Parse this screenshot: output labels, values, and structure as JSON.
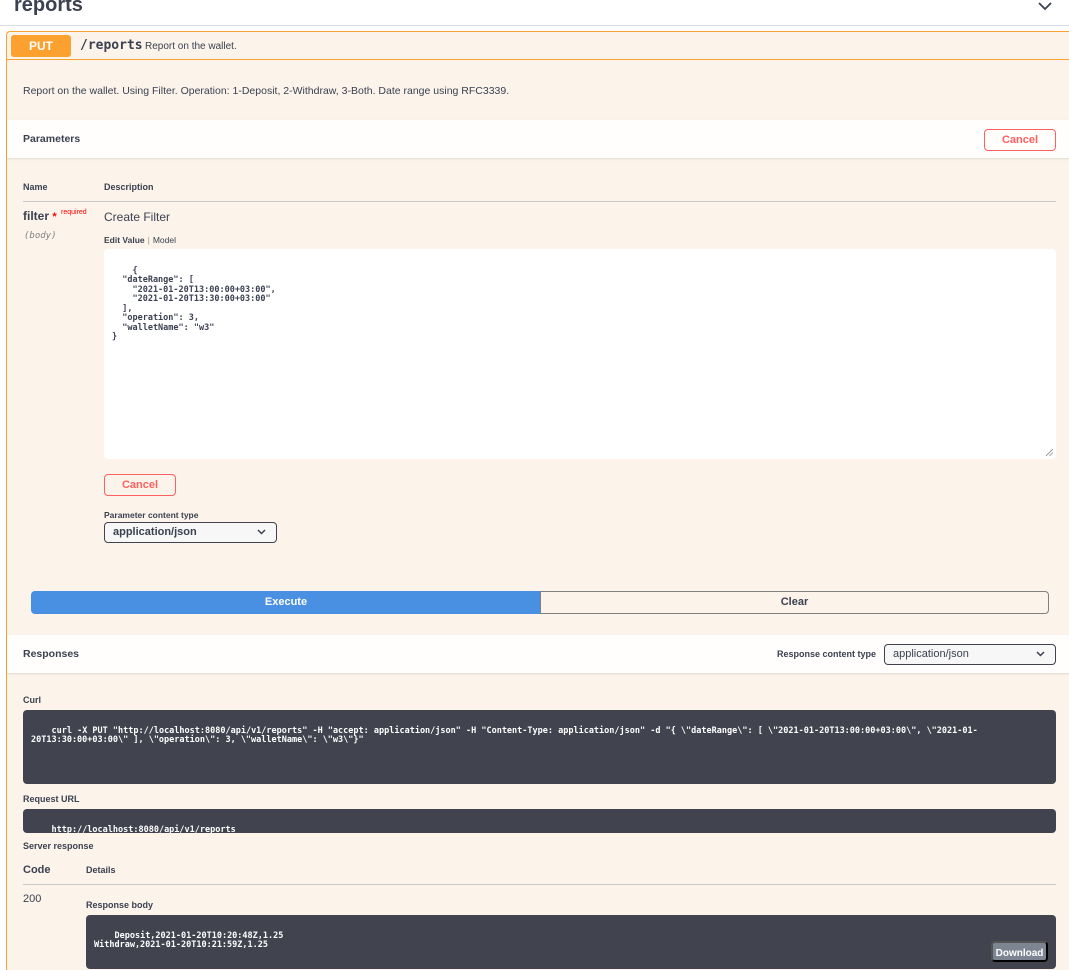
{
  "tag": {
    "title": "reports"
  },
  "operation": {
    "method": "PUT",
    "path": "/reports",
    "summary": "Report on the wallet.",
    "description": "Report on the wallet. Using Filter. Operation: 1-Deposit, 2-Withdraw, 3-Both. Date range using RFC3339."
  },
  "parameters": {
    "title": "Parameters",
    "cancel_label": "Cancel",
    "col_name": "Name",
    "col_description": "Description",
    "param": {
      "name": "filter",
      "star": "*",
      "required": "required",
      "in": "(body)",
      "description": "Create Filter",
      "tab_edit": "Edit Value",
      "tab_sep": "|",
      "tab_model": "Model",
      "value": "{\n  \"dateRange\": [\n    \"2021-01-20T13:00:00+03:00\",\n    \"2021-01-20T13:30:00+03:00\"\n  ],\n  \"operation\": 3,\n  \"walletName\": \"w3\"\n}"
    },
    "inner_cancel_label": "Cancel",
    "content_type_label": "Parameter content type",
    "content_type_value": "application/json"
  },
  "actions": {
    "execute": "Execute",
    "clear": "Clear"
  },
  "responses": {
    "title": "Responses",
    "content_type_label": "Response content type",
    "content_type_value": "application/json",
    "curl_label": "Curl",
    "curl": "curl -X PUT \"http://localhost:8080/api/v1/reports\" -H \"accept: application/json\" -H \"Content-Type: application/json\" -d \"{ \\\"dateRange\\\": [ \\\"2021-01-20T13:00:00+03:00\\\", \\\"2021-01-20T13:30:00+03:00\\\" ], \\\"operation\\\": 3, \\\"walletName\\\": \\\"w3\\\"}\"",
    "request_url_label": "Request URL",
    "request_url": "http://localhost:8080/api/v1/reports",
    "server_response_label": "Server response",
    "col_code": "Code",
    "col_details": "Details",
    "code": "200",
    "body_label": "Response body",
    "body": "Deposit,2021-01-20T10:20:48Z,1.25\nWithdraw,2021-01-20T10:21:59Z,1.25",
    "download": "Download"
  },
  "colors": {
    "put": "#fca130",
    "execute": "#4990e2",
    "cancel": "#ff6060",
    "dark_block": "#41444e"
  }
}
